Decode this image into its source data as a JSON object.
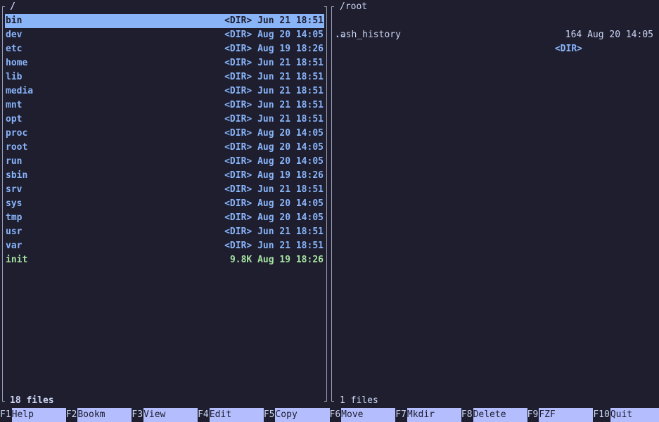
{
  "left_panel": {
    "path": "/",
    "entries": [
      {
        "name": "bin",
        "meta": "<DIR> Jun 21 18:51",
        "kind": "dir",
        "selected": true
      },
      {
        "name": "dev",
        "meta": "<DIR> Aug 20 14:05",
        "kind": "dir"
      },
      {
        "name": "etc",
        "meta": "<DIR> Aug 19 18:26",
        "kind": "dir"
      },
      {
        "name": "home",
        "meta": "<DIR> Jun 21 18:51",
        "kind": "dir"
      },
      {
        "name": "lib",
        "meta": "<DIR> Jun 21 18:51",
        "kind": "dir"
      },
      {
        "name": "media",
        "meta": "<DIR> Jun 21 18:51",
        "kind": "dir"
      },
      {
        "name": "mnt",
        "meta": "<DIR> Jun 21 18:51",
        "kind": "dir"
      },
      {
        "name": "opt",
        "meta": "<DIR> Jun 21 18:51",
        "kind": "dir"
      },
      {
        "name": "proc",
        "meta": "<DIR> Aug 20 14:05",
        "kind": "dir"
      },
      {
        "name": "root",
        "meta": "<DIR> Aug 20 14:05",
        "kind": "dir"
      },
      {
        "name": "run",
        "meta": "<DIR> Aug 20 14:05",
        "kind": "dir"
      },
      {
        "name": "sbin",
        "meta": "<DIR> Aug 19 18:26",
        "kind": "dir"
      },
      {
        "name": "srv",
        "meta": "<DIR> Jun 21 18:51",
        "kind": "dir"
      },
      {
        "name": "sys",
        "meta": "<DIR> Aug 20 14:05",
        "kind": "dir"
      },
      {
        "name": "tmp",
        "meta": "<DIR> Aug 20 14:05",
        "kind": "dir"
      },
      {
        "name": "usr",
        "meta": "<DIR> Jun 21 18:51",
        "kind": "dir"
      },
      {
        "name": "var",
        "meta": "<DIR> Jun 21 18:51",
        "kind": "dir"
      },
      {
        "name": "init",
        "meta": "9.8K Aug 19 18:26",
        "kind": "file"
      }
    ],
    "count_label": "18 files"
  },
  "right_panel": {
    "path": "/root",
    "updir": {
      "name": "..",
      "meta": "<DIR>"
    },
    "entries": [
      {
        "name": ".ash_history",
        "meta": "164 Aug 20 14:05",
        "kind": "plain"
      }
    ],
    "count_label": "1 files"
  },
  "function_keys": [
    {
      "key": "F1",
      "label": "Help"
    },
    {
      "key": "F2",
      "label": "Bookm"
    },
    {
      "key": "F3",
      "label": "View"
    },
    {
      "key": "F4",
      "label": "Edit"
    },
    {
      "key": "F5",
      "label": "Copy"
    },
    {
      "key": "F6",
      "label": "Move"
    },
    {
      "key": "F7",
      "label": "Mkdir"
    },
    {
      "key": "F8",
      "label": "Delete"
    },
    {
      "key": "F9",
      "label": "FZF"
    },
    {
      "key": "F10",
      "label": "Quit"
    }
  ],
  "colors": {
    "background": "#1e1e2e",
    "directory": "#89b4fa",
    "file_exec": "#a6e3a1",
    "selection": "#8ab4f8",
    "fkey_label_bg": "#b4befe"
  }
}
